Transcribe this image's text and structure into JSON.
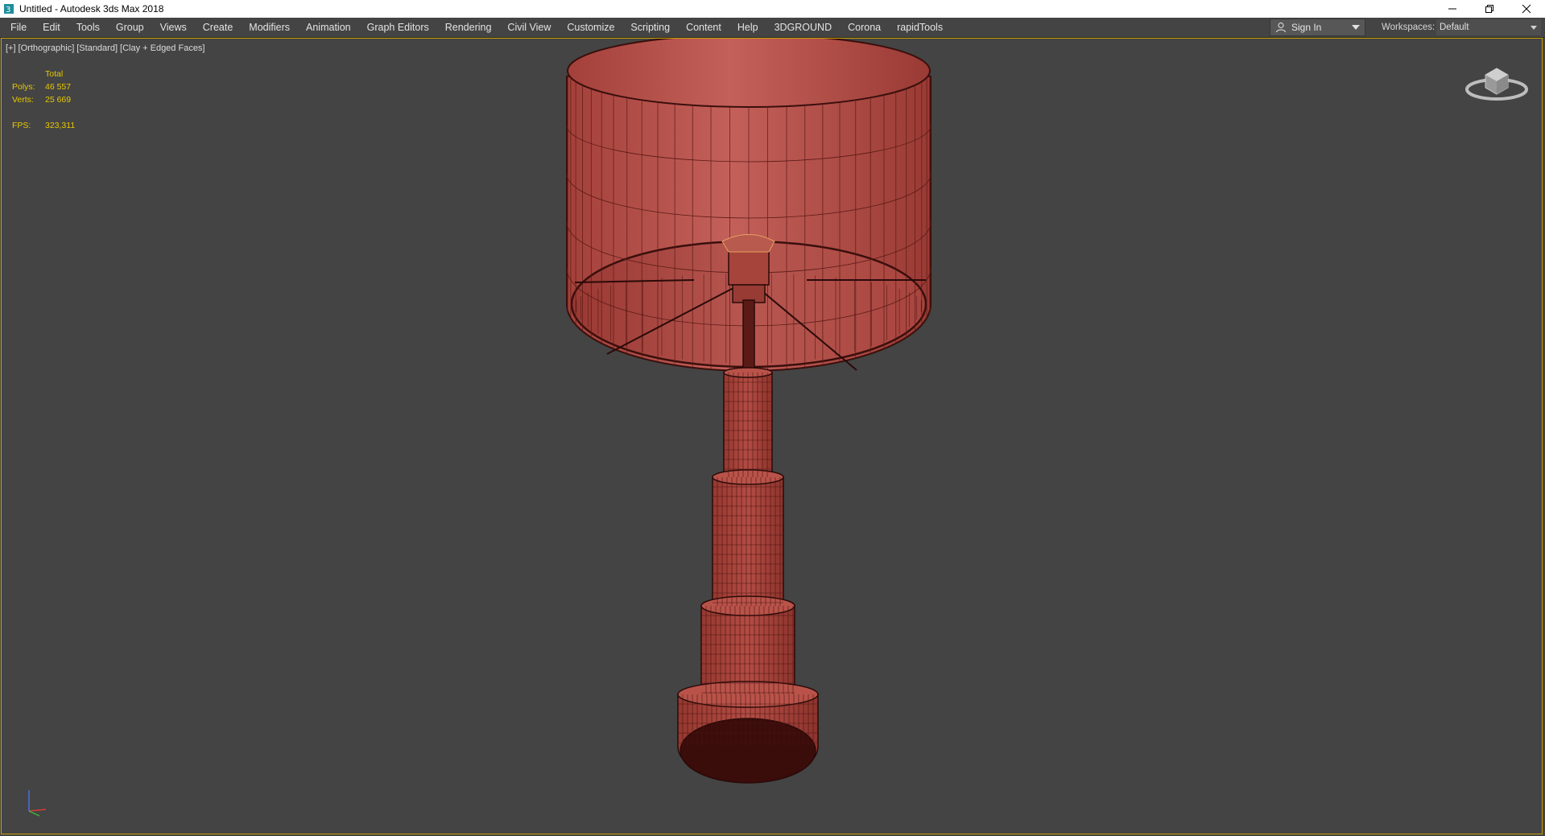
{
  "window": {
    "title": "Untitled - Autodesk 3ds Max 2018",
    "controls": [
      "minimize",
      "restore",
      "close"
    ]
  },
  "menu": {
    "items": [
      "File",
      "Edit",
      "Tools",
      "Group",
      "Views",
      "Create",
      "Modifiers",
      "Animation",
      "Graph Editors",
      "Rendering",
      "Civil View",
      "Customize",
      "Scripting",
      "Content",
      "Help",
      "3DGROUND",
      "Corona",
      "rapidTools"
    ]
  },
  "account": {
    "sign_in_label": "Sign In"
  },
  "workspaces": {
    "label": "Workspaces:",
    "value": "Default"
  },
  "viewport": {
    "label_plus": "[+]",
    "label_view": "[Orthographic]",
    "label_shading": "[Standard]",
    "label_mode": "[Clay + Edged Faces]",
    "stats": {
      "header": "Total",
      "polys_label": "Polys:",
      "polys_value": "46 557",
      "verts_label": "Verts:",
      "verts_value": "25 669",
      "fps_label": "FPS:",
      "fps_value": "323,311"
    },
    "border_color": "#c8a000",
    "stats_color": "#e8c800",
    "model_color": "#b4463f"
  }
}
